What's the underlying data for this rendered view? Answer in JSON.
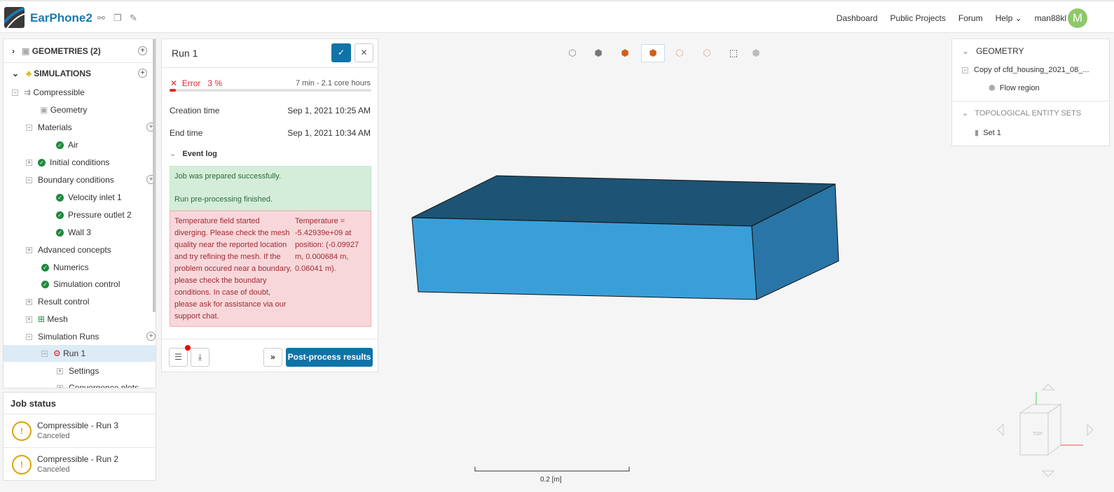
{
  "header": {
    "title": "EarPhone2",
    "nav": [
      "Dashboard",
      "Public Projects",
      "Forum",
      "Help"
    ],
    "user": "man88kl",
    "avatar": "M"
  },
  "tree": {
    "geometries": "GEOMETRIES (2)",
    "simulations": "SIMULATIONS",
    "items": [
      "Compressible",
      "Geometry",
      "Materials",
      "Air",
      "Initial conditions",
      "Boundary conditions",
      "Velocity inlet 1",
      "Pressure outlet 2",
      "Wall 3",
      "Advanced concepts",
      "Numerics",
      "Simulation control",
      "Result control",
      "Mesh",
      "Simulation Runs",
      "Run 1",
      "Settings",
      "Convergence plots"
    ]
  },
  "job_status": {
    "title": "Job status",
    "jobs": [
      {
        "name": "Compressible - Run 3",
        "status": "Canceled"
      },
      {
        "name": "Compressible - Run 2",
        "status": "Canceled"
      }
    ]
  },
  "run": {
    "title": "Run 1",
    "status": "Error",
    "progress": "3 %",
    "progress_value": 3,
    "duration": "7 min - 2.1 core hours",
    "creation_label": "Creation time",
    "creation": "Sep 1, 2021 10:25 AM",
    "end_label": "End time",
    "end": "Sep 1, 2021 10:34 AM",
    "event_log": "Event log",
    "log_ok": [
      "Job was prepared successfully.",
      "Run pre-processing finished."
    ],
    "log_err": "Temperature field started diverging. Please check the mesh quality near the reported location and try refining the mesh. If the problem occured near a boundary, please check the boundary conditions. In case of doubt, please ask for assistance via our support chat.",
    "log_err_detail": "Temperature = -5.42939e+09 at position: (-0.09927 m, 0.000684 m, 0.06041 m).",
    "postprocess": "Post-process results"
  },
  "right": {
    "geometry": "GEOMETRY",
    "file": "Copy of cfd_housing_2021_08_...",
    "region": "Flow region",
    "sets": "TOPOLOGICAL ENTITY SETS",
    "set1": "Set 1"
  },
  "scale": "0.2 [m]",
  "colors": {
    "accent": "#0f73a8",
    "error": "#e0262f",
    "box_top": "#1d5374",
    "box_front": "#3a9fd9",
    "box_side": "#2a75a8"
  }
}
